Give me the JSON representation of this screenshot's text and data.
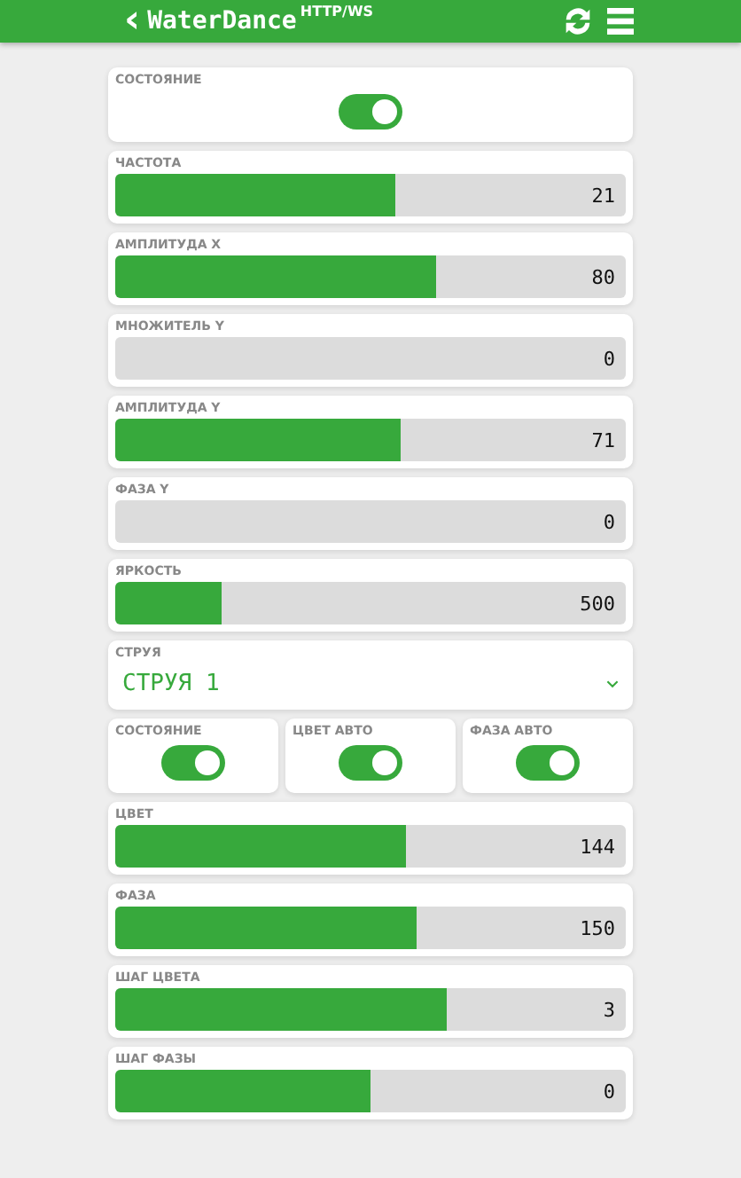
{
  "header": {
    "back": "‹",
    "title": "WaterDance",
    "subtitle": "HTTP/WS"
  },
  "items": [
    {
      "kind": "switch",
      "label": "СОСТОЯНИЕ",
      "on": true
    },
    {
      "kind": "slider",
      "label": "ЧАСТОТА",
      "level": 0.55,
      "reading": "21"
    },
    {
      "kind": "slider",
      "label": "АМПЛИТУДА X",
      "level": 0.63,
      "reading": "80"
    },
    {
      "kind": "slider",
      "label": "МНОЖИТЕЛЬ Y",
      "reading": "0"
    },
    {
      "kind": "slider",
      "label": "АМПЛИТУДА Y",
      "level": 0.56,
      "reading": "71"
    },
    {
      "kind": "slider",
      "label": "ФАЗА Y",
      "reading": "0"
    },
    {
      "kind": "slider",
      "label": "ЯРКОСТЬ",
      "level": 0.21,
      "reading": "500"
    },
    {
      "kind": "select",
      "label": "СТРУЯ",
      "value": "СТРУЯ 1"
    },
    {
      "kind": "switches",
      "switches": [
        {
          "label": "СОСТОЯНИЕ",
          "on": true
        },
        {
          "label": "ЦВЕТ АВТО",
          "on": true
        },
        {
          "label": "ФАЗА АВТО",
          "on": true
        }
      ]
    },
    {
      "kind": "slider",
      "label": "ЦВЕТ",
      "level": 0.57,
      "reading": "144"
    },
    {
      "kind": "slider",
      "label": "ФАЗА",
      "level": 0.59,
      "reading": "150"
    },
    {
      "kind": "slider",
      "label": "ШАГ ЦВЕТА",
      "level": 0.65,
      "reading": "3"
    },
    {
      "kind": "slider",
      "label": "ШАГ ФАЗЫ",
      "level": 0.5,
      "reading": "0"
    }
  ]
}
